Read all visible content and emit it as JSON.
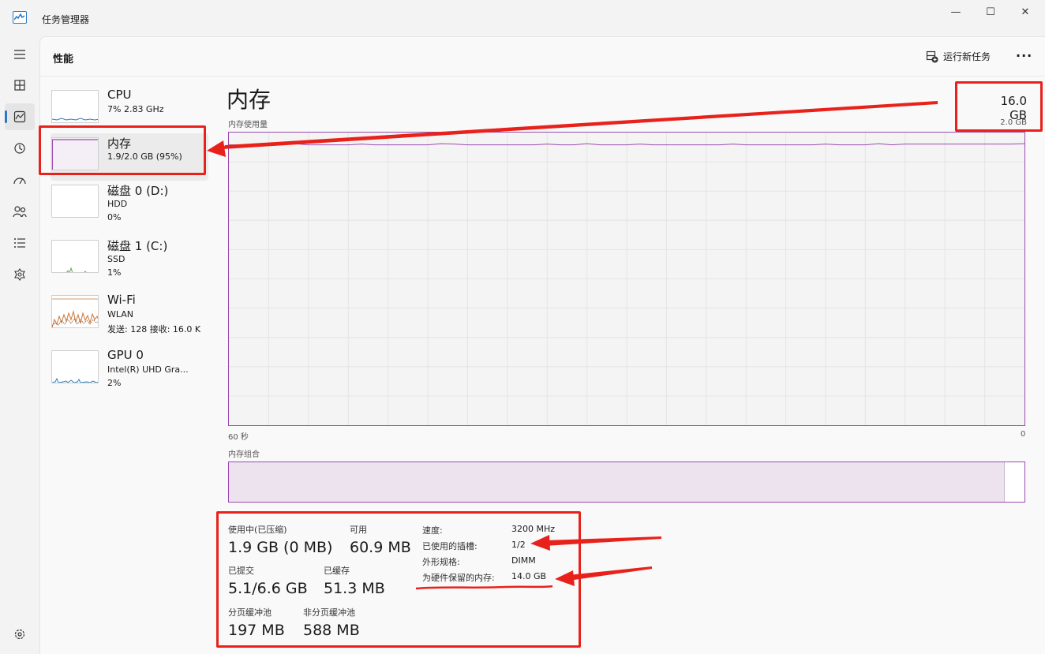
{
  "window": {
    "title": "任务管理器",
    "minimize": "—",
    "maximize": "☐",
    "close": "✕"
  },
  "header": {
    "page_title": "性能",
    "run_new_task": "运行新任务",
    "more": "···"
  },
  "rail": {
    "items": [
      "menu-icon",
      "processes-icon",
      "performance-icon",
      "app-history-icon",
      "startup-icon",
      "users-icon",
      "details-icon",
      "services-icon",
      "settings-icon"
    ],
    "active": "performance-icon"
  },
  "devices": [
    {
      "name": "CPU",
      "sub1": "7%  2.83 GHz",
      "sub2": ""
    },
    {
      "name": "内存",
      "sub1": "1.9/2.0 GB (95%)",
      "sub2": ""
    },
    {
      "name": "磁盘 0 (D:)",
      "sub1": "HDD",
      "sub2": "0%"
    },
    {
      "name": "磁盘 1 (C:)",
      "sub1": "SSD",
      "sub2": "1%"
    },
    {
      "name": "Wi-Fi",
      "sub1": "WLAN",
      "sub2": "发送: 128  接收: 16.0 K"
    },
    {
      "name": "GPU 0",
      "sub1": "Intel(R) UHD Gra...",
      "sub2": "2%"
    }
  ],
  "memory": {
    "title": "内存",
    "total_label": "16.0 GB",
    "usage_label": "内存使用量",
    "chart_max": "2.0 GB",
    "x_left": "60 秒",
    "x_right": "0",
    "composition_label": "内存组合",
    "usage_level": 0.95,
    "stats": {
      "in_use_label": "使用中(已压缩)",
      "in_use": "1.9 GB (0 MB)",
      "available_label": "可用",
      "available": "60.9 MB",
      "committed_label": "已提交",
      "committed": "5.1/6.6 GB",
      "cached_label": "已缓存",
      "cached": "51.3 MB",
      "paged_label": "分页缓冲池",
      "paged": "197 MB",
      "nonpaged_label": "非分页缓冲池",
      "nonpaged": "588 MB"
    },
    "details": [
      {
        "key": "速度:",
        "value": "3200 MHz"
      },
      {
        "key": "已使用的插槽:",
        "value": "1/2"
      },
      {
        "key": "外形规格:",
        "value": "DIMM"
      },
      {
        "key": "为硬件保留的内存:",
        "value": "14.0 GB"
      }
    ]
  },
  "colors": {
    "memory_line": "#9b4bb0",
    "annotation": "#e8221b",
    "accent": "#2b78c4"
  }
}
